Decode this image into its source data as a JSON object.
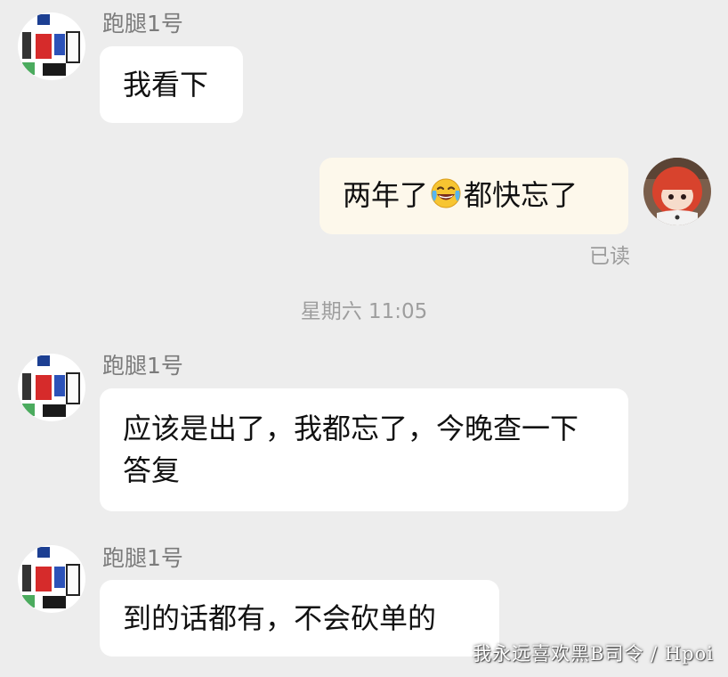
{
  "messages": [
    {
      "sender": "跑腿1号",
      "text": "我看下"
    },
    {
      "sender": "me",
      "text_before": "两年了",
      "emoji": "tears-of-joy",
      "text_after": "都快忘了",
      "status": "已读"
    },
    {
      "sender": "跑腿1号",
      "text": "应该是出了，我都忘了，今晚查一下答复"
    },
    {
      "sender": "跑腿1号",
      "text": "到的话都有，不会砍单的"
    }
  ],
  "time_divider": "星期六 11:05",
  "watermark": "我永远喜欢黑B司令 / Hpoi",
  "colors": {
    "background": "#ededed",
    "bubble_other": "#ffffff",
    "bubble_me": "#fdf8eb",
    "meta_text": "#9e9e9e"
  }
}
